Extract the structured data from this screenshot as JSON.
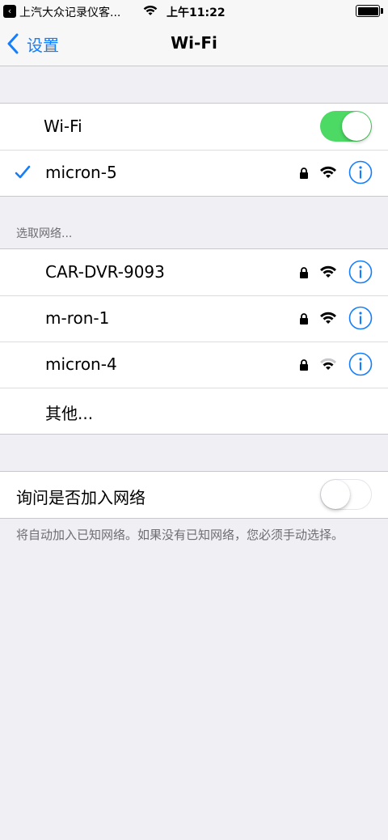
{
  "status_bar": {
    "back_app": "上汽大众记录仪客...",
    "time": "上午11:22"
  },
  "nav": {
    "back_label": "设置",
    "title": "Wi-Fi"
  },
  "wifi_group": {
    "toggle_label": "Wi-Fi",
    "toggle_on": true,
    "connected_network": "micron-5"
  },
  "choose_network": {
    "header": "选取网络...",
    "networks": [
      {
        "name": "CAR-DVR-9093",
        "secured": true,
        "signal": "full"
      },
      {
        "name": "m-ron-1",
        "secured": true,
        "signal": "full"
      },
      {
        "name": "micron-4",
        "secured": true,
        "signal": "medium"
      }
    ],
    "other_label": "其他..."
  },
  "ask_join": {
    "label": "询问是否加入网络",
    "toggle_on": false,
    "footer": "将自动加入已知网络。如果没有已知网络，您必须手动选择。"
  },
  "colors": {
    "accent": "#147efb",
    "toggle_on": "#4cd964",
    "background": "#efeff4"
  }
}
